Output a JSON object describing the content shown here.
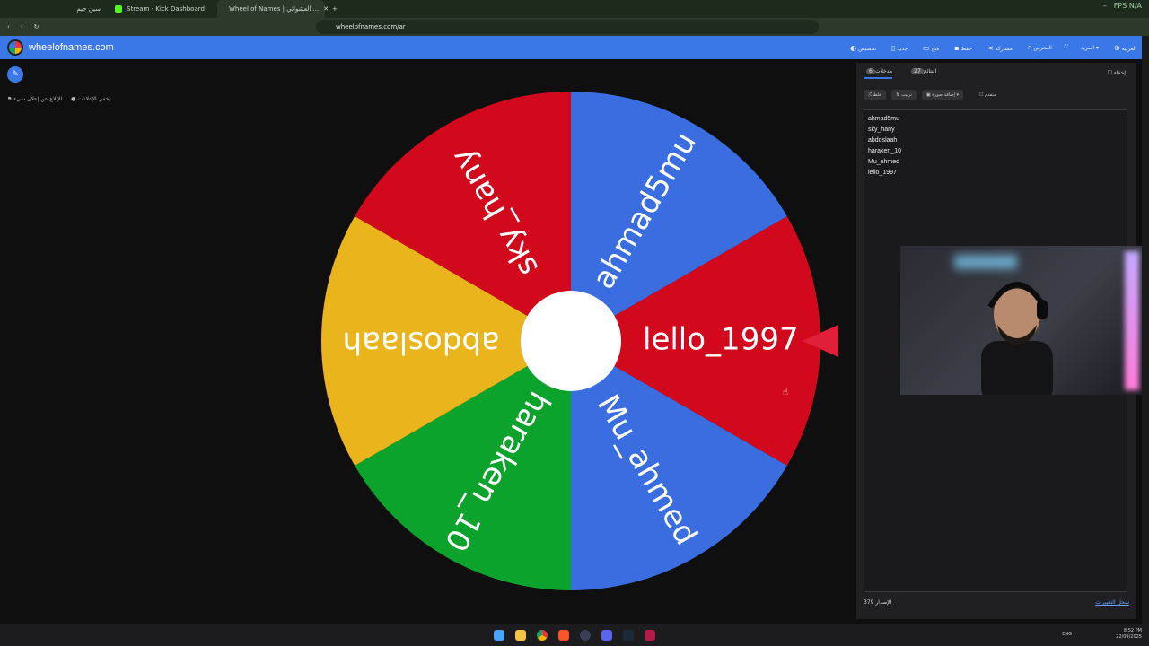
{
  "browser": {
    "tabs": [
      {
        "label": "سين جيم",
        "color": "#e8353b"
      },
      {
        "label": "Stream - Kick Dashboard",
        "color": "#53fc18"
      },
      {
        "label": "Wheel of Names | العشوائي ...",
        "color": "#3b78e7"
      }
    ],
    "new_tab": "+",
    "url": "wheelofnames.com/ar",
    "fps": "FPS N/A"
  },
  "app": {
    "logo_text": "wheelofnames.com",
    "menu": [
      "تخصيص",
      "جديد",
      "فتح",
      "حفظ",
      "مشاركة",
      "المعرض",
      "المزيد",
      "العربية"
    ]
  },
  "left": {
    "edit_icon": "pencil-icon",
    "hide_ads": "إخفي الإعلانات",
    "report_ad": "الإبلاغ عن إعلان سيء"
  },
  "wheel": {
    "segments": [
      {
        "name": "lello_1997",
        "color": "#d2091c"
      },
      {
        "name": "Mu_ahmed",
        "color": "#3a6ee0"
      },
      {
        "name": "haraken_10",
        "color": "#0ba32c"
      },
      {
        "name": "abdoslaah",
        "color": "#e9b41c"
      },
      {
        "name": "sky_hany",
        "color": "#d2091c"
      },
      {
        "name": "ahmad5mu",
        "color": "#3a6ee0"
      }
    ],
    "pointer_color": "#e0203a"
  },
  "panel": {
    "tab_entries": "مدخلات",
    "tab_entries_count": "6",
    "tab_results": "النتائج",
    "tab_results_count": "27",
    "hide_label": "إخفاء",
    "shuffle": "خلط",
    "sort": "ترتيب",
    "add_image": "إضافة صورة",
    "advanced": "متقدم",
    "entries_text": "ahmad5mu\nsky_hany\nabdoslaah\nharaken_10\nMu_ahmed\nlello_1997",
    "version_label": "الإصدار",
    "version_value": "379",
    "changelog": "سجل التغييرات"
  },
  "taskbar": {
    "lang": "ENG",
    "time": "8:52 PM",
    "date": "22/09/2025"
  }
}
